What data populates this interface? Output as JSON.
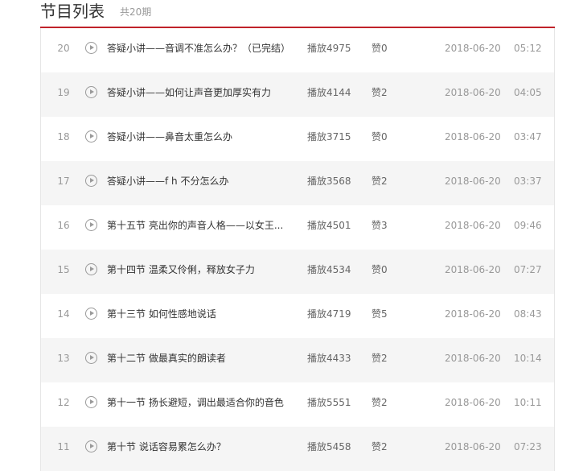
{
  "header": {
    "title": "节目列表",
    "count": "共20期"
  },
  "episodes": [
    {
      "num": "20",
      "title": "答疑小讲——音调不准怎么办？（已完结）",
      "plays": "播放4975",
      "likes": "赞0",
      "date": "2018-06-20",
      "duration": "05:12"
    },
    {
      "num": "19",
      "title": "答疑小讲——如何让声音更加厚实有力",
      "plays": "播放4144",
      "likes": "赞2",
      "date": "2018-06-20",
      "duration": "04:05"
    },
    {
      "num": "18",
      "title": "答疑小讲——鼻音太重怎么办",
      "plays": "播放3715",
      "likes": "赞0",
      "date": "2018-06-20",
      "duration": "03:47"
    },
    {
      "num": "17",
      "title": "答疑小讲——f h 不分怎么办",
      "plays": "播放3568",
      "likes": "赞2",
      "date": "2018-06-20",
      "duration": "03:37"
    },
    {
      "num": "16",
      "title": "第十五节 亮出你的声音人格——以女王...",
      "plays": "播放4501",
      "likes": "赞3",
      "date": "2018-06-20",
      "duration": "09:46"
    },
    {
      "num": "15",
      "title": "第十四节 温柔又伶俐，释放女子力",
      "plays": "播放4534",
      "likes": "赞0",
      "date": "2018-06-20",
      "duration": "07:27"
    },
    {
      "num": "14",
      "title": "第十三节 如何性感地说话",
      "plays": "播放4719",
      "likes": "赞5",
      "date": "2018-06-20",
      "duration": "08:43"
    },
    {
      "num": "13",
      "title": "第十二节 做最真实的朗读者",
      "plays": "播放4433",
      "likes": "赞2",
      "date": "2018-06-20",
      "duration": "10:14"
    },
    {
      "num": "12",
      "title": "第十一节 扬长避短，调出最适合你的音色",
      "plays": "播放5551",
      "likes": "赞2",
      "date": "2018-06-20",
      "duration": "10:11"
    },
    {
      "num": "11",
      "title": "第十节 说话容易累怎么办？",
      "plays": "播放5458",
      "likes": "赞2",
      "date": "2018-06-20",
      "duration": "07:23"
    }
  ]
}
